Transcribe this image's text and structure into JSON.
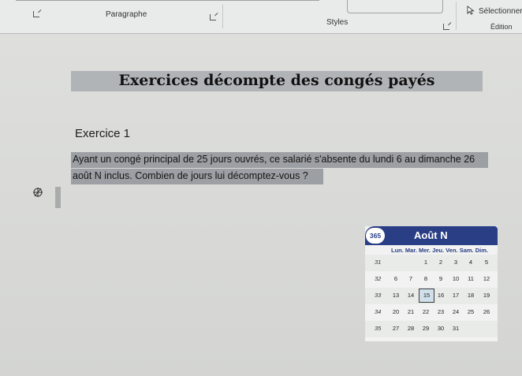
{
  "ribbon": {
    "paragraph_label": "Paragraphe",
    "styles_label": "Styles",
    "select_label": "Sélectionner",
    "edit_label": "Édition"
  },
  "document": {
    "title": "Exercices décompte des congés payés",
    "exercise_title": "Exercice 1",
    "text_line1": "Ayant un congé principal de 25 jours ouvrés, ce salarié s'absente du lundi 6 au dimanche 26",
    "text_line2": "août N inclus. Combien de jours lui décomptez-vous ?"
  },
  "calendar": {
    "badge": "365",
    "month": "Août   N",
    "day_header": "Lun. Mar. Mer. Jeu. Ven. Sam. Dim.",
    "highlight": "15",
    "weeks": [
      {
        "num": "31",
        "days": [
          "",
          "",
          "1",
          "2",
          "3",
          "4",
          "5"
        ]
      },
      {
        "num": "32",
        "days": [
          "6",
          "7",
          "8",
          "9",
          "10",
          "11",
          "12"
        ]
      },
      {
        "num": "33",
        "days": [
          "13",
          "14",
          "15",
          "16",
          "17",
          "18",
          "19"
        ]
      },
      {
        "num": "34",
        "days": [
          "20",
          "21",
          "22",
          "23",
          "24",
          "25",
          "26"
        ]
      },
      {
        "num": "35",
        "days": [
          "27",
          "28",
          "29",
          "30",
          "31",
          "",
          ""
        ]
      }
    ]
  },
  "icons": {
    "launcher": "dialog-launcher-icon",
    "select": "cursor-arrow-icon",
    "margin_mark": "cross-symbol-icon"
  }
}
